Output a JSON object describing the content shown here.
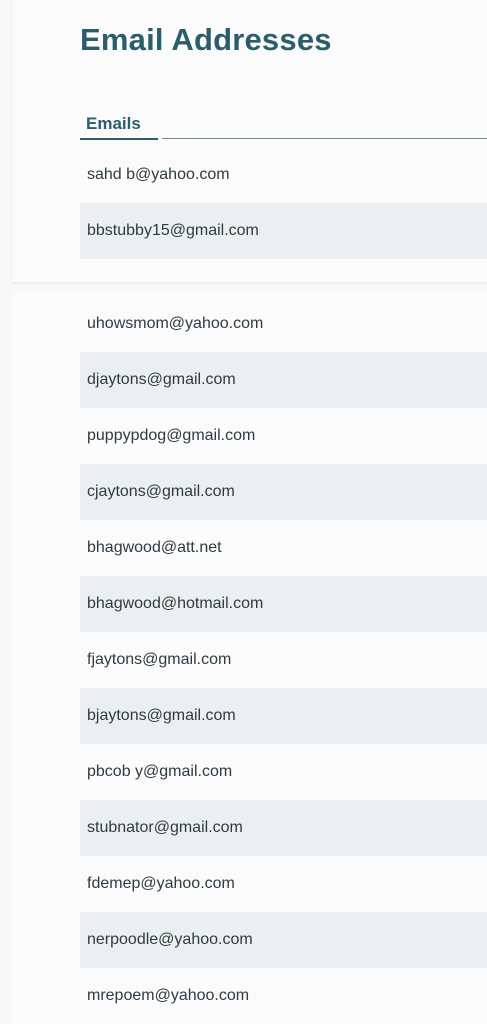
{
  "page": {
    "title": "Email Addresses",
    "column_header": "Emails"
  },
  "emails": [
    "sahd b@yahoo.com",
    "bbstubby15@gmail.com",
    "",
    "uhowsmom@yahoo.com",
    "djaytons@gmail.com",
    "puppypdog@gmail.com",
    "cjaytons@gmail.com",
    "bhagwood@att.net",
    "bhagwood@hotmail.com",
    "fjaytons@gmail.com",
    "bjaytons@gmail.com",
    "pbcob y@gmail.com",
    "stubnator@gmail.com",
    "fdemep@yahoo.com",
    "nerpoodle@yahoo.com",
    "mrepoem@yahoo.com"
  ],
  "colors": {
    "accent": "#2b5e6c",
    "row_alt": "#ebeff1",
    "text": "#2f3b42"
  }
}
